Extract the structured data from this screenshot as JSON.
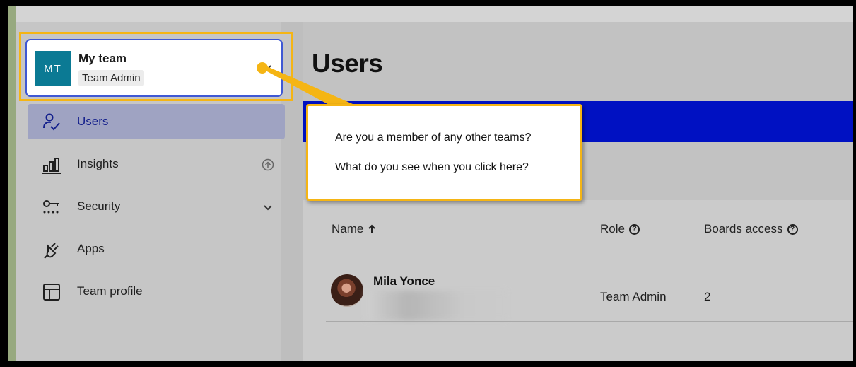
{
  "team": {
    "avatar_initials": "MT",
    "name": "My team",
    "role": "Team Admin",
    "chevron_icon": "chevron-down-icon"
  },
  "sidebar": {
    "items": [
      {
        "label": "Users",
        "icon": "users-icon",
        "active": true
      },
      {
        "label": "Insights",
        "icon": "bar-chart-icon",
        "trailing_icon": "upgrade-arrow-icon"
      },
      {
        "label": "Security",
        "icon": "key-icon",
        "trailing_icon": "chevron-down-icon"
      },
      {
        "label": "Apps",
        "icon": "plug-icon"
      },
      {
        "label": "Team profile",
        "icon": "layout-icon"
      }
    ]
  },
  "main": {
    "title": "Users",
    "table": {
      "columns": [
        {
          "label": "Name",
          "icon": "sort-up-arrow-icon"
        },
        {
          "label": "Role",
          "icon": "help-circle-icon"
        },
        {
          "label": "Boards access",
          "icon": "help-circle-icon"
        }
      ],
      "rows": [
        {
          "name": "Mila Yonce",
          "role": "Team Admin",
          "boards_access": "2"
        }
      ]
    }
  },
  "callout": {
    "line_1": "Are you a member of any other teams?",
    "line_2": "What do you see when you click here?"
  },
  "colors": {
    "highlight_border": "#f5b514",
    "team_avatar_bg": "#0b7a94",
    "active_nav_bg": "#9fa3c2",
    "banner_blue": "#0011c2",
    "card_border": "#3f58d4"
  }
}
